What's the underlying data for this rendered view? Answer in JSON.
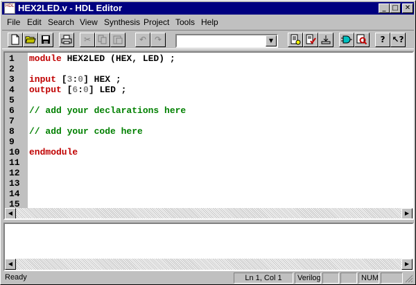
{
  "window": {
    "title": "HEX2LED.v - HDL Editor",
    "icon_text": "HDL",
    "controls": {
      "minimize": "_",
      "maximize": "□",
      "close": "✕"
    }
  },
  "menu": [
    "File",
    "Edit",
    "Search",
    "View",
    "Synthesis",
    "Project",
    "Tools",
    "Help"
  ],
  "toolbar": {
    "buttons": [
      "new-file-icon",
      "open-folder-icon",
      "save-icon",
      "print-icon",
      "cut-icon",
      "copy-icon",
      "paste-icon",
      "undo-icon",
      "redo-icon",
      "build-icon",
      "check-syntax-icon",
      "implement-icon",
      "simulate-icon",
      "find-icon",
      "help-icon",
      "context-help-icon"
    ],
    "combo_value": ""
  },
  "editor": {
    "lines": [
      {
        "n": "1",
        "parts": [
          {
            "t": "module",
            "c": "kw"
          },
          {
            "t": " HEX2LED (HEX, LED) ;",
            "c": "pl"
          }
        ]
      },
      {
        "n": "2",
        "parts": []
      },
      {
        "n": "3",
        "parts": [
          {
            "t": "input",
            "c": "kw"
          },
          {
            "t": " [",
            "c": "pl"
          },
          {
            "t": "3",
            "c": "num"
          },
          {
            "t": ":",
            "c": "pl"
          },
          {
            "t": "0",
            "c": "num"
          },
          {
            "t": "] HEX ;",
            "c": "pl"
          }
        ]
      },
      {
        "n": "4",
        "parts": [
          {
            "t": "output",
            "c": "kw"
          },
          {
            "t": " [",
            "c": "pl"
          },
          {
            "t": "6",
            "c": "num"
          },
          {
            "t": ":",
            "c": "pl"
          },
          {
            "t": "0",
            "c": "num"
          },
          {
            "t": "] LED ;",
            "c": "pl"
          }
        ]
      },
      {
        "n": "5",
        "parts": []
      },
      {
        "n": "6",
        "parts": [
          {
            "t": "// add your declarations here",
            "c": "cm"
          }
        ]
      },
      {
        "n": "7",
        "parts": []
      },
      {
        "n": "8",
        "parts": [
          {
            "t": "// add your code here",
            "c": "cm"
          }
        ]
      },
      {
        "n": "9",
        "parts": []
      },
      {
        "n": "10",
        "parts": [
          {
            "t": "endmodule",
            "c": "kw"
          }
        ]
      },
      {
        "n": "11",
        "parts": []
      },
      {
        "n": "12",
        "parts": []
      },
      {
        "n": "13",
        "parts": []
      },
      {
        "n": "14",
        "parts": []
      },
      {
        "n": "15",
        "parts": []
      }
    ],
    "colors": {
      "keyword": "#c00000",
      "comment": "#008000",
      "number": "#808080"
    }
  },
  "statusbar": {
    "message": "Ready",
    "position": "Ln 1, Col 1",
    "language": "Verilog",
    "cell3": "",
    "cell4": "",
    "num": "NUM",
    "cell6": ""
  }
}
